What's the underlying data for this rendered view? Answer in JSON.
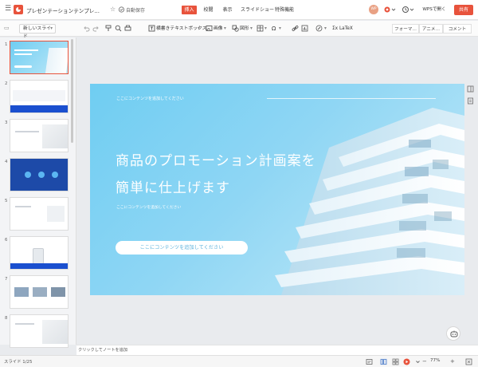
{
  "titlebar": {
    "doc_title": "プレゼンテーションテンプレート…",
    "autosave": "自動保存",
    "tabs": [
      {
        "label": "挿入",
        "active": true
      },
      {
        "label": "校閲",
        "active": false
      },
      {
        "label": "表示",
        "active": false
      },
      {
        "label": "スライドショー",
        "active": false
      },
      {
        "label": "特殊機能",
        "active": false
      }
    ],
    "avatar_text": "WP",
    "wps_open": "WPSで開く",
    "share": "共有"
  },
  "toolbar": {
    "new_slide": "新しいスライド",
    "text_box": "横書きテキストボックス",
    "image": "画像",
    "shape": "図形",
    "latex": "LaTeX",
    "right_tabs": [
      "フォーマ…",
      "アニメ…",
      "コメント"
    ]
  },
  "thumbnails": [
    "1",
    "2",
    "3",
    "4",
    "5",
    "6",
    "7",
    "8"
  ],
  "slide": {
    "top_label": "ここにコンテンツを追加してください",
    "title_line1": "商品のプロモーション計画案を",
    "title_line2": "簡単に仕上げます",
    "sub_label": "ここにコンテンツを追加してください",
    "pill_text": "ここにコンテンツを追加してください"
  },
  "notes": {
    "placeholder": "クリックしてノートを追加"
  },
  "statusbar": {
    "slide_count": "スライド 1/25",
    "zoom": "77%"
  },
  "colors": {
    "accent": "#e8533c",
    "slide_bg": "#79d0f3",
    "thumb_blue": "#1a4fcf"
  }
}
